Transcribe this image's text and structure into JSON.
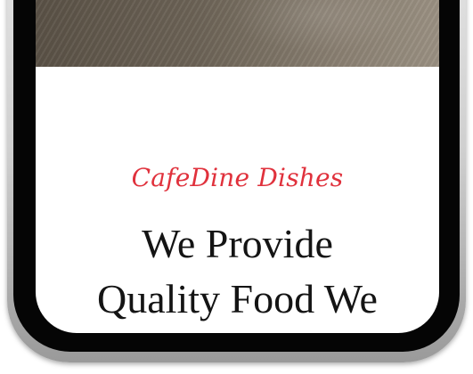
{
  "page": {
    "brand_name": "CafeDine Dishes",
    "headline_line1": "We Provide",
    "headline_line2": "Quality Food We"
  },
  "colors": {
    "brand": "#e0313c",
    "headline": "#141414",
    "frame": "#cfcfcf",
    "bezel": "#050505"
  }
}
